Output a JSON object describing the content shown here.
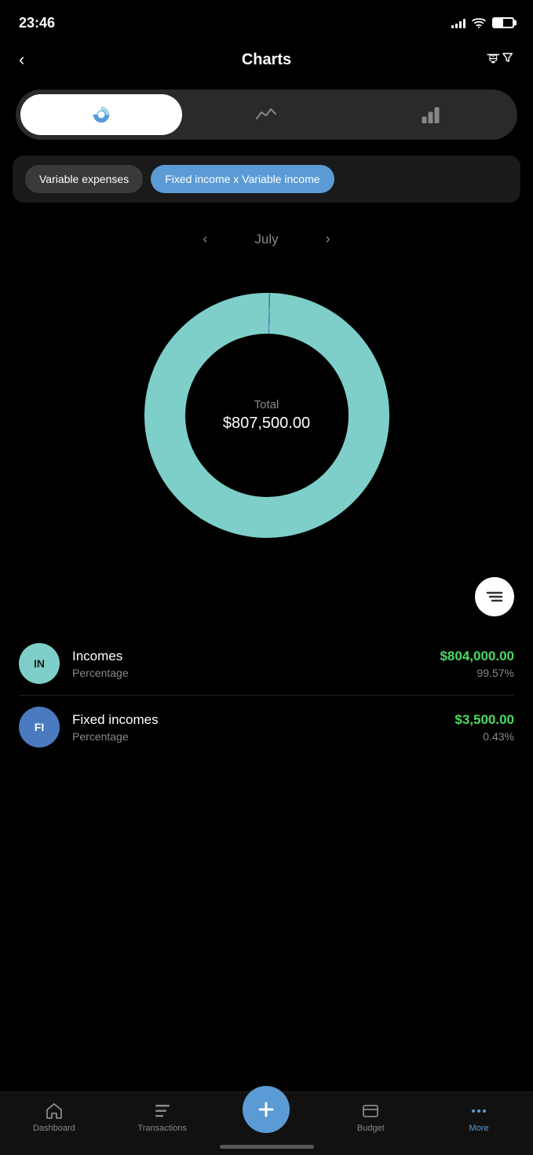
{
  "statusBar": {
    "time": "23:46",
    "signalBars": [
      4,
      6,
      8,
      10,
      12
    ],
    "batteryPercent": 50
  },
  "header": {
    "backLabel": "‹",
    "title": "Charts",
    "filterIcon": "filter"
  },
  "tabSwitcher": {
    "items": [
      {
        "id": "pie",
        "icon": "pie-chart",
        "active": true
      },
      {
        "id": "line",
        "icon": "line-chart",
        "active": false
      },
      {
        "id": "bar",
        "icon": "bar-chart",
        "active": false
      }
    ]
  },
  "categoryTabs": [
    {
      "id": "variable-expenses",
      "label": "Variable expenses",
      "active": false
    },
    {
      "id": "fixed-income-variable",
      "label": "Fixed income x Variable income",
      "active": true
    }
  ],
  "monthNav": {
    "prevArrow": "‹",
    "nextArrow": "›",
    "month": "July"
  },
  "donutChart": {
    "centerLabel": "Total",
    "centerValue": "$807,500.00",
    "segments": [
      {
        "label": "Incomes",
        "color": "#7ecfc9",
        "percentage": 99.57,
        "startAngle": 90
      },
      {
        "label": "Fixed incomes",
        "color": "#4a7abf",
        "percentage": 0.43,
        "startAngle": -0.5
      }
    ]
  },
  "sortButton": {
    "icon": "sort-lines"
  },
  "legendItems": [
    {
      "id": "incomes",
      "initials": "IN",
      "avatarColor": "#7ecfc9",
      "name": "Incomes",
      "subLabel": "Percentage",
      "amount": "$804,000.00",
      "percentage": "99.57%"
    },
    {
      "id": "fixed-incomes",
      "initials": "FI",
      "avatarColor": "#4a7abf",
      "name": "Fixed incomes",
      "subLabel": "Percentage",
      "amount": "$3,500.00",
      "percentage": "0.43%"
    }
  ],
  "bottomNav": {
    "items": [
      {
        "id": "dashboard",
        "label": "Dashboard",
        "icon": "home"
      },
      {
        "id": "transactions",
        "label": "Transactions",
        "icon": "list"
      },
      {
        "id": "plus",
        "label": "+",
        "icon": "plus"
      },
      {
        "id": "budget",
        "label": "Budget",
        "icon": "budget"
      },
      {
        "id": "more",
        "label": "More",
        "icon": "more",
        "active": true
      }
    ]
  }
}
